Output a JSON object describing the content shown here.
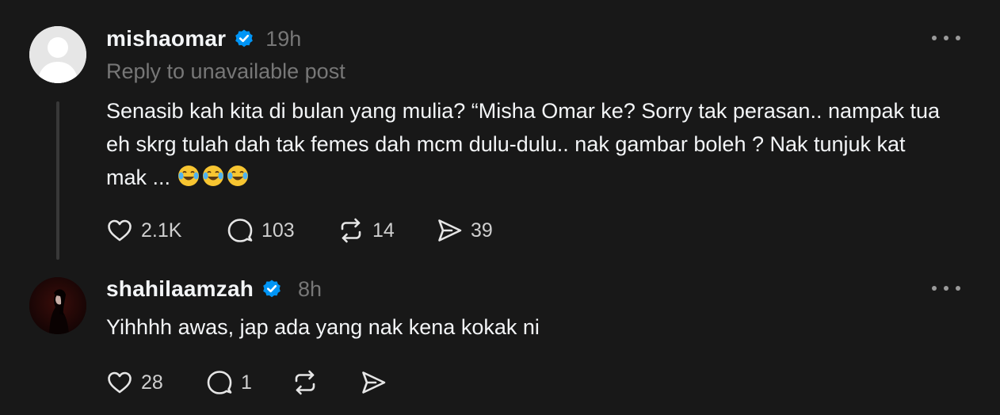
{
  "posts": [
    {
      "username": "mishaomar",
      "time": "19h",
      "reply_to": "Reply to unavailable post",
      "text": "Senasib kah kita di bulan yang mulia? “Misha Omar ke? Sorry tak perasan.. nampak tua eh skrg tulah dah tak femes dah mcm dulu-dulu.. nak gambar boleh ? Nak tunjuk kat mak ...",
      "emojis": [
        "joy-emoji",
        "joy-emoji",
        "joy-emoji"
      ],
      "likes": "2.1K",
      "comments": "103",
      "reposts": "14",
      "shares": "39"
    },
    {
      "username": "shahilaamzah",
      "time": "8h",
      "text": "Yihhhh awas, jap ada yang nak kena kokak ni",
      "likes": "28",
      "comments": "1"
    }
  ],
  "colors": {
    "background": "#181818",
    "verified": "#0095f6",
    "muted_text": "#777777"
  },
  "icons": [
    "verified-badge-icon",
    "more-icon",
    "heart-icon",
    "comment-icon",
    "repost-icon",
    "share-icon"
  ]
}
